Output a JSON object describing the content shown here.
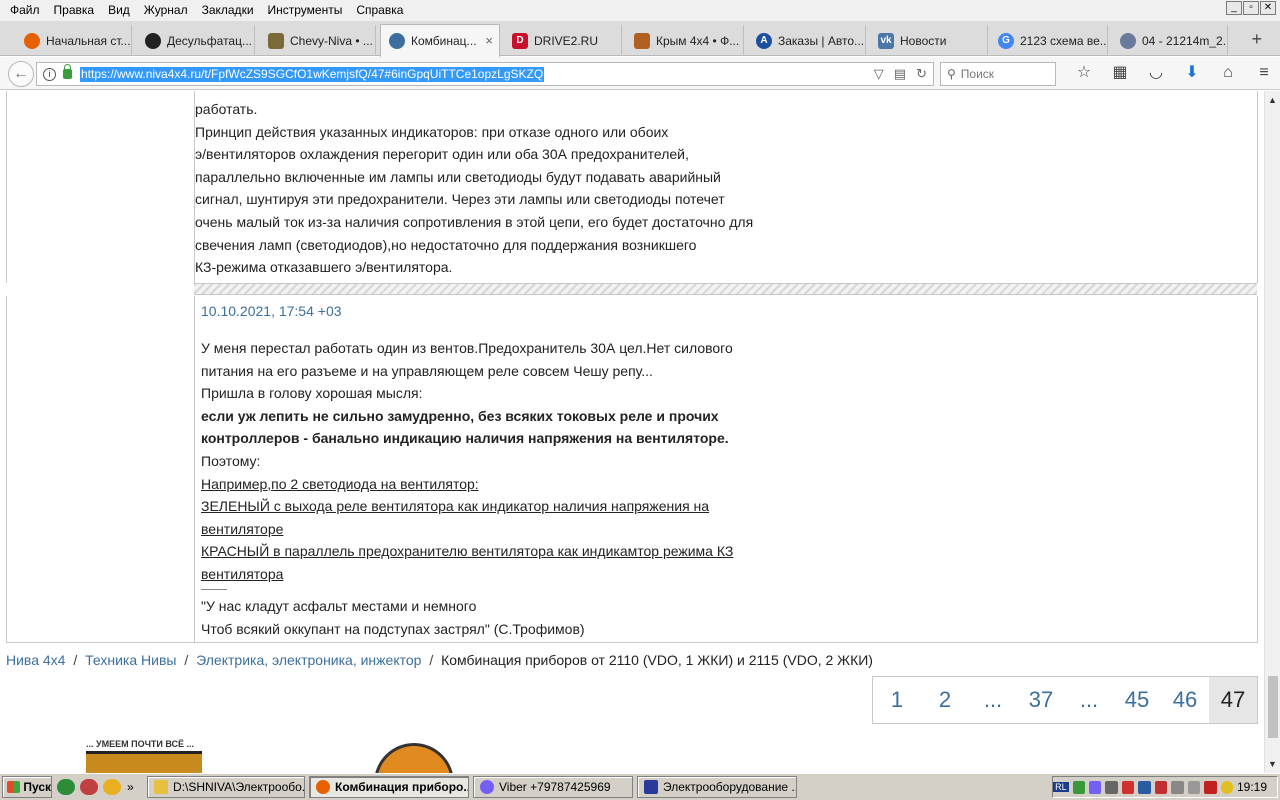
{
  "menu": [
    "Файл",
    "Правка",
    "Вид",
    "Журнал",
    "Закладки",
    "Инструменты",
    "Справка"
  ],
  "window_controls": [
    "_",
    "▫",
    "✕"
  ],
  "tabs": [
    {
      "label": "Начальная ст...",
      "icon": "firefox-icon",
      "color": "#e66000"
    },
    {
      "label": "Десульфатац...",
      "icon": "soccer-icon",
      "color": "#222222"
    },
    {
      "label": "Chevy-Niva • ...",
      "icon": "niva-icon",
      "color": "#7a6a3a"
    },
    {
      "label": "Комбинац...",
      "icon": "forum-icon",
      "color": "#3c6f9e",
      "active": true
    },
    {
      "label": "DRIVE2.RU",
      "icon": "drive2-icon",
      "color": "#c8102e"
    },
    {
      "label": "Крым 4х4 • Ф...",
      "icon": "forum-icon",
      "color": "#b06020"
    },
    {
      "label": "Заказы | Авто...",
      "icon": "autodoc-icon",
      "color": "#1d4fa0"
    },
    {
      "label": "Новости",
      "icon": "vk-icon",
      "color": "#4a76a8"
    },
    {
      "label": "2123 схема ве...",
      "icon": "google-icon",
      "color": "#4285f4"
    },
    {
      "label": "04 - 21214m_2...",
      "icon": "gear-icon",
      "color": "#6a7a9a"
    }
  ],
  "tab_close": "×",
  "new_tab": "+",
  "nav": {
    "url": "https://www.niva4x4.ru/t/FpfWcZS9SGCfO1wKemjsfQ/47#6inGpqUiTTCe1opzLgSKZQ",
    "search_placeholder": "Поиск"
  },
  "post1": {
    "lines": [
      "работать.",
      "Принцип действия указанных индикаторов: при отказе одного или обоих",
      "э/вентиляторов охлаждения перегорит один или оба 30А предохранителей,",
      "параллельно включенные им лампы или светодиоды будут подавать аварийный",
      "сигнал, шунтируя эти предохранители. Через эти лампы или светодиоды потечет",
      "очень малый ток из-за наличия сопротивления в этой цепи, его будет достаточно для",
      "свечения ламп (светодиодов),но недостаточно для поддержания возникшего",
      "КЗ-режима отказавшего э/вентилятора."
    ]
  },
  "post2": {
    "date": "10.10.2021, 17:54 +03",
    "lines": [
      {
        "text": "У меня перестал работать один из вентов.Предохранитель 30А цел.Нет силового",
        "style": ""
      },
      {
        "text": "питания на его разъеме и на управляющем реле совсем Чешу репу...",
        "style": ""
      },
      {
        "text": "Пришла в голову хорошая мысля:",
        "style": ""
      },
      {
        "text": "если уж лепить не сильно замудренно, без всяких токовых реле и прочих",
        "style": "bold"
      },
      {
        "text": "контроллеров - банально индикацию наличия напряжения на вентиляторе.",
        "style": "bold"
      },
      {
        "text": "Поэтому:",
        "style": ""
      },
      {
        "text": "Например,по 2 светодиода на вентилятор:",
        "style": "ul"
      },
      {
        "text": "ЗЕЛЕНЫЙ с выхода реле вентилятора как индикатор наличия напряжения на",
        "style": "ul"
      },
      {
        "text": "вентиляторе",
        "style": "ul"
      },
      {
        "text": "КРАСНЫЙ в параллель предохранителю вентилятора как индикамтор режима КЗ",
        "style": "ul"
      },
      {
        "text": "вентилятора",
        "style": "ul"
      }
    ],
    "signature": [
      "\"У нас кладут асфальт местами и немного",
      "Чтоб всякий оккупант на подступах застрял\" (С.Трофимов)"
    ]
  },
  "breadcrumb": {
    "items": [
      "Нива 4х4",
      "Техника Нивы",
      "Электрика, электроника, инжектор"
    ],
    "current": "Комбинация приборов от 2110 (VDO, 1 ЖКИ) и 2115 (VDO, 2 ЖКИ)",
    "separator": "/"
  },
  "pager": {
    "pages": [
      "1",
      "2",
      "...",
      "37",
      "...",
      "45",
      "46"
    ],
    "current": "47"
  },
  "banner": {
    "text": "... УМЕЕМ ПОЧТИ ВСЁ ..."
  },
  "taskbar": {
    "start": "Пуск",
    "ql_more": "»",
    "buttons": [
      {
        "label": "D:\\SHNIVA\\Электрообо...",
        "icon": "folder-icon",
        "color": "#e8c040",
        "active": false
      },
      {
        "label": "Комбинация приборо...",
        "icon": "firefox-icon",
        "color": "#e66000",
        "active": true
      },
      {
        "label": "Viber +79787425969",
        "icon": "viber-icon",
        "color": "#7360f2",
        "active": false
      },
      {
        "label": "Электрооборудование ...",
        "icon": "app-icon",
        "color": "#2a3a9a",
        "active": false
      }
    ],
    "lang": "RL",
    "clock": "19:19"
  }
}
